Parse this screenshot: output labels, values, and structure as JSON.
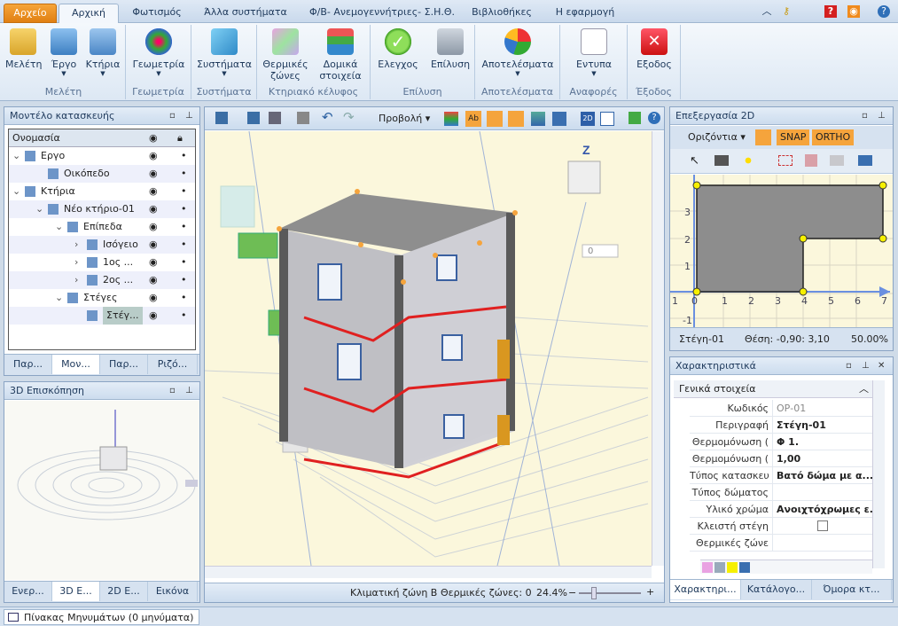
{
  "tabs": [
    "Αρχείο",
    "Αρχική",
    "Φωτισμός",
    "Άλλα συστήματα",
    "Φ/Β- Ανεμογεννήτριες- Σ.Η.Θ.",
    "Βιβλιοθήκες",
    "Η εφαρμογή"
  ],
  "ribbon": {
    "groups": [
      "Μελέτη",
      "Γεωμετρία",
      "Συστήματα",
      "Κτηριακό κέλυφος",
      "Επίλυση",
      "Αποτελέσματα",
      "Αναφορές",
      "Έξοδος"
    ],
    "buttons": [
      "Μελέτη",
      "Έργο",
      "Κτήρια",
      "Γεωμετρία",
      "Συστήματα",
      "Θερμικές ζώνες",
      "Δομικά στοιχεία",
      "Ελεγχος",
      "Επίλυση",
      "Αποτελέσματα",
      "Εντυπα",
      "Εξοδος"
    ]
  },
  "model": {
    "title": "Μοντέλο κατασκευής",
    "col_name": "Ονομασία",
    "rows": [
      "Εργο",
      "Οικόπεδο",
      "Κτήρια",
      "Νέο κτήριο-01",
      "Επίπεδα",
      "Ισόγειο",
      "1ος ...",
      "2ος ...",
      "Στέγες",
      "Στέγ..."
    ],
    "tabs": [
      "Παρ...",
      "Μον...",
      "Παρ...",
      "Ριζό..."
    ]
  },
  "preview": {
    "title": "3D Επισκόπηση",
    "tabs": [
      "Ενερ...",
      "3D E...",
      "2D E...",
      "Εικόνα"
    ]
  },
  "view3d": {
    "menu": "Προβολή",
    "angle": "0",
    "status_zone": "Κλιματική ζώνη Β",
    "status_zones": "Θερμικές ζώνες: 0",
    "zoom": "24.4%"
  },
  "edit2d": {
    "title": "Επεξεργασία 2D",
    "view": "Οριζόντια",
    "snap": "SNAP",
    "ortho": "ORTHO",
    "status_name": "Στέγη-01",
    "status_pos": "Θέση: -0,90: 3,10",
    "status_zoom": "50.00%",
    "xticks": [
      "1",
      "0",
      "1",
      "2",
      "3",
      "4",
      "5",
      "6",
      "7"
    ],
    "yticks": [
      "3",
      "2",
      "1",
      "-1"
    ]
  },
  "props": {
    "title": "Χαρακτηριστικά",
    "section": "Γενικά στοιχεία",
    "rows": [
      [
        "Κωδικός",
        "ΟΡ-01"
      ],
      [
        "Περιγραφή",
        "Στέγη-01"
      ],
      [
        "Θερμομόνωση (",
        "Φ 1."
      ],
      [
        "Θερμομόνωση (",
        "1,00"
      ],
      [
        "Τύπος κατασκευ",
        "Βατό δώμα  με α..."
      ],
      [
        "Τύπος δώματος",
        ""
      ],
      [
        "Υλικό χρώμα",
        "Ανοιχτόχρωμες ε..."
      ],
      [
        "Κλειστή στέγη",
        ""
      ],
      [
        "Θερμικές ζώνε",
        ""
      ]
    ],
    "tabs": [
      "Χαρακτηρι...",
      "Κατάλογο...",
      "Όμορα κτ..."
    ]
  },
  "statusbar": "Πίνακας Μηνυμάτων (0 μηνύματα)"
}
